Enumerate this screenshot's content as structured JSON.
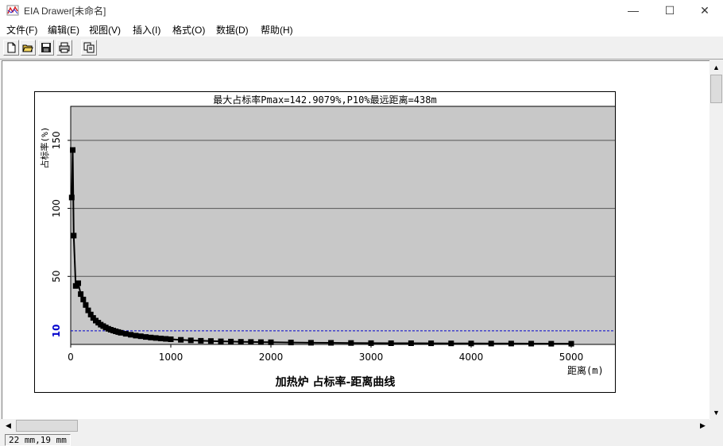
{
  "window": {
    "title": "EIA Drawer[未命名]",
    "minimize_glyph": "—",
    "maximize_glyph": "☐",
    "close_glyph": "✕"
  },
  "menu": [
    "文件(F)",
    "编辑(E)",
    "视图(V)",
    "插入(I)",
    "格式(O)",
    "数据(D)",
    "帮助(H)"
  ],
  "toolbar": {
    "buttons": [
      "new-file-icon",
      "open-folder-icon",
      "save-disk-icon",
      "print-icon",
      "copy-icon"
    ]
  },
  "status": {
    "position": "22 mm,19 mm"
  },
  "colors": {
    "plot_bg": "#c8c8c8",
    "series": "#000000",
    "threshold": "#0000cc",
    "gridline": "#555555"
  },
  "chart_data": {
    "type": "line",
    "title": "最大占标率Pmax=142.9079%,P10%最远距离=438m",
    "caption": "加热炉 占标率-距离曲线",
    "xlabel": "距离(m)",
    "ylabel": "占标率(%)",
    "xlim": [
      0,
      5500
    ],
    "ylim": [
      0,
      175
    ],
    "xticks": [
      0,
      1000,
      2000,
      3000,
      4000,
      5000
    ],
    "yticks": [
      50,
      100,
      150
    ],
    "threshold": {
      "value": 10,
      "label": "10"
    },
    "grid": "horizontal",
    "series": [
      {
        "x": [
          10,
          20,
          30,
          50,
          75,
          100,
          125,
          150,
          175,
          200,
          225,
          250,
          275,
          300,
          325,
          350,
          375,
          400,
          425,
          450,
          475,
          500,
          550,
          600,
          650,
          700,
          750,
          800,
          850,
          900,
          950,
          1000,
          1100,
          1200,
          1300,
          1400,
          1500,
          1600,
          1700,
          1800,
          1900,
          2000,
          2200,
          2400,
          2600,
          2800,
          3000,
          3200,
          3400,
          3600,
          3800,
          4000,
          4200,
          4400,
          4600,
          4800,
          5000
        ],
        "values": [
          108,
          142.9,
          80,
          43,
          45,
          37,
          33,
          29,
          25,
          22,
          19.5,
          17.5,
          16,
          14.5,
          13.5,
          12.5,
          11.5,
          10.8,
          10.2,
          9.6,
          9.1,
          8.6,
          7.8,
          7.1,
          6.5,
          6.0,
          5.5,
          5.1,
          4.7,
          4.4,
          4.1,
          3.8,
          3.4,
          3.0,
          2.7,
          2.5,
          2.3,
          2.1,
          1.95,
          1.8,
          1.7,
          1.6,
          1.4,
          1.25,
          1.15,
          1.05,
          0.95,
          0.9,
          0.85,
          0.8,
          0.75,
          0.7,
          0.66,
          0.62,
          0.58,
          0.55,
          0.52
        ]
      }
    ]
  }
}
